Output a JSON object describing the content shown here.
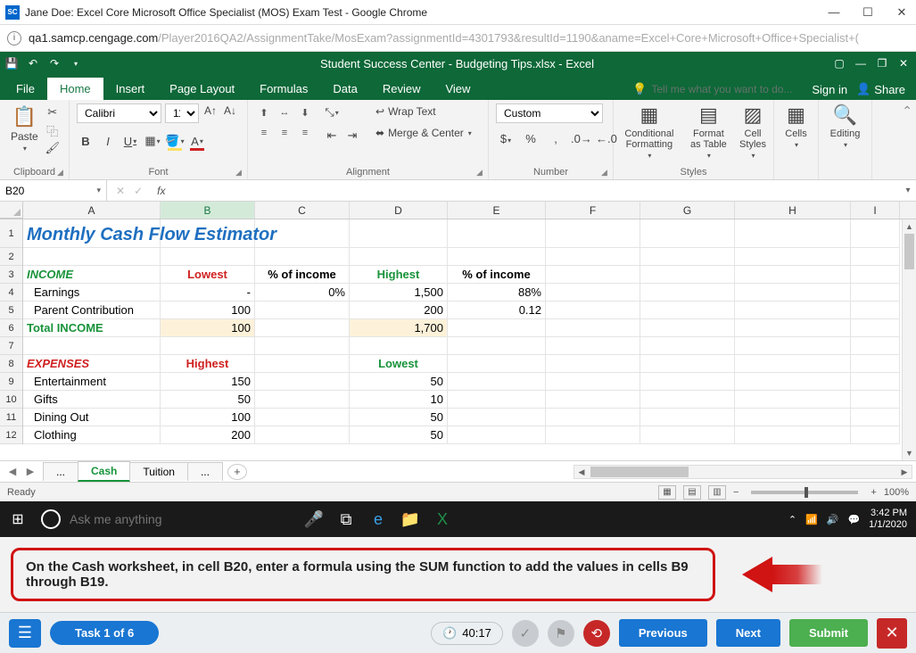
{
  "chrome": {
    "title": "Jane Doe: Excel Core Microsoft Office Specialist (MOS) Exam Test - Google Chrome",
    "url_prefix": "qa1.samcp.cengage.com",
    "url_suffix": "/Player2016QA2/AssignmentTake/MosExam?assignmentId=4301793&resultId=1190&aname=Excel+Core+Microsoft+Office+Specialist+("
  },
  "excel": {
    "title": "Student Success Center - Budgeting Tips.xlsx - Excel",
    "tabs": [
      "File",
      "Home",
      "Insert",
      "Page Layout",
      "Formulas",
      "Data",
      "Review",
      "View"
    ],
    "active_tab": "Home",
    "tell_me": "Tell me what you want to do...",
    "signin": "Sign in",
    "share": "Share",
    "groups": {
      "clipboard": "Clipboard",
      "font": "Font",
      "alignment": "Alignment",
      "number": "Number",
      "styles": "Styles",
      "cells": "Cells",
      "editing": "Editing"
    },
    "font": {
      "name": "Calibri",
      "size": "11"
    },
    "wrap": "Wrap Text",
    "merge": "Merge & Center",
    "paste": "Paste",
    "number_format": "Custom",
    "cond_format": "Conditional Formatting",
    "format_table": "Format as Table",
    "cell_styles": "Cell Styles",
    "cells_btn": "Cells",
    "editing_btn": "Editing",
    "name_box": "B20",
    "status": "Ready",
    "zoom": "100%",
    "sheet_tabs": {
      "ellipsis": "...",
      "cash": "Cash",
      "tuition": "Tuition"
    }
  },
  "grid": {
    "title": "Monthly Cash Flow Estimator",
    "income_hdr": "INCOME",
    "lowest": "Lowest",
    "highest": "Highest",
    "pct": "% of income",
    "earnings": "Earnings",
    "parent": "Parent Contribution",
    "total_income": "Total INCOME",
    "expenses_hdr": "EXPENSES",
    "entertainment": "Entertainment",
    "gifts": "Gifts",
    "dining": "Dining Out",
    "clothing": "Clothing",
    "vals": {
      "earn_b": "-",
      "earn_c": "0%",
      "earn_d": "1,500",
      "earn_e": "88%",
      "par_b": "100",
      "par_d": "200",
      "par_e": "0.12",
      "tot_b": "100",
      "tot_d": "1,700",
      "ent_b": "150",
      "ent_d": "50",
      "gift_b": "50",
      "gift_d": "10",
      "din_b": "100",
      "din_d": "50",
      "clo_b": "200",
      "clo_d": "50"
    }
  },
  "taskbar": {
    "cortana": "Ask me anything",
    "time": "3:42 PM",
    "date": "1/1/2020"
  },
  "instruction": "On the Cash worksheet, in cell B20, enter a formula using the SUM function to add the values in cells B9 through B19.",
  "bottom": {
    "task": "Task 1 of 6",
    "timer": "40:17",
    "previous": "Previous",
    "next": "Next",
    "submit": "Submit"
  }
}
